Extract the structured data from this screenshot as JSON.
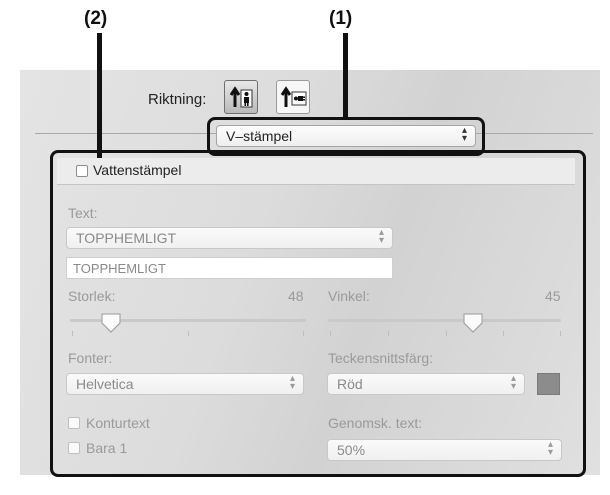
{
  "callouts": {
    "c1": "(1)",
    "c2": "(2)"
  },
  "direction": {
    "label": "Riktning:",
    "options": [
      "portrait-person-icon",
      "landscape-person-icon"
    ],
    "selected_index": 0
  },
  "stamp_type_select": {
    "value": "V–stämpel"
  },
  "watermark": {
    "checkbox_label": "Vattenstämpel",
    "checked": false
  },
  "text": {
    "label": "Text:",
    "select_value": "TOPPHEMLIGT",
    "field_value": "TOPPHEMLIGT"
  },
  "size": {
    "label": "Storlek:",
    "value": "48"
  },
  "angle": {
    "label": "Vinkel:",
    "value": "45"
  },
  "fonts": {
    "label": "Fonter:",
    "value": "Helvetica"
  },
  "font_color": {
    "label": "Teckensnittsfärg:",
    "value": "Röd",
    "swatch_color": "#8c8c8c"
  },
  "outline_text": {
    "label": "Konturtext",
    "checked": false
  },
  "only_first": {
    "label": "Bara 1",
    "checked": false
  },
  "transparency": {
    "label": "Genomsk. text:",
    "value": "50%"
  }
}
